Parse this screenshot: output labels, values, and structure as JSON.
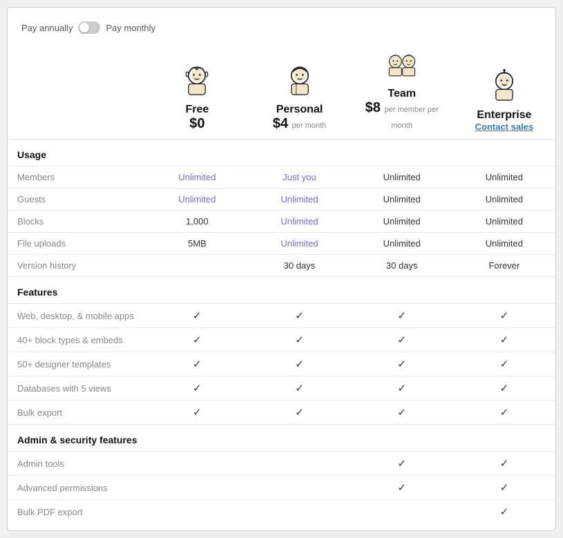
{
  "billing": {
    "pay_annually": "Pay annually",
    "pay_monthly": "Pay monthly"
  },
  "plans": [
    {
      "id": "free",
      "name": "Free",
      "price": "$0",
      "price_sub": "",
      "contact": null,
      "avatar": "free"
    },
    {
      "id": "personal",
      "name": "Personal",
      "price": "$4",
      "price_sub": "per month",
      "contact": null,
      "avatar": "personal"
    },
    {
      "id": "team",
      "name": "Team",
      "price": "$8",
      "price_sub": "per member per month",
      "contact": null,
      "avatar": "team"
    },
    {
      "id": "enterprise",
      "name": "Enterprise",
      "price": null,
      "price_sub": null,
      "contact": "Contact sales",
      "avatar": "enterprise"
    }
  ],
  "sections": [
    {
      "title": "Usage",
      "rows": [
        {
          "label": "Members",
          "values": [
            {
              "text": "Unlimited",
              "type": "purple"
            },
            {
              "text": "Just you",
              "type": "purple"
            },
            {
              "text": "Unlimited",
              "type": "normal"
            },
            {
              "text": "Unlimited",
              "type": "normal"
            }
          ]
        },
        {
          "label": "Guests",
          "values": [
            {
              "text": "Unlimited",
              "type": "purple"
            },
            {
              "text": "Unlimited",
              "type": "purple"
            },
            {
              "text": "Unlimited",
              "type": "normal"
            },
            {
              "text": "Unlimited",
              "type": "normal"
            }
          ]
        },
        {
          "label": "Blocks",
          "values": [
            {
              "text": "1,000",
              "type": "normal"
            },
            {
              "text": "Unlimited",
              "type": "purple"
            },
            {
              "text": "Unlimited",
              "type": "normal"
            },
            {
              "text": "Unlimited",
              "type": "normal"
            }
          ]
        },
        {
          "label": "File uploads",
          "values": [
            {
              "text": "5MB",
              "type": "normal"
            },
            {
              "text": "Unlimited",
              "type": "purple"
            },
            {
              "text": "Unlimited",
              "type": "normal"
            },
            {
              "text": "Unlimited",
              "type": "normal"
            }
          ]
        },
        {
          "label": "Version history",
          "values": [
            {
              "text": "",
              "type": "normal"
            },
            {
              "text": "30 days",
              "type": "normal"
            },
            {
              "text": "30 days",
              "type": "normal"
            },
            {
              "text": "Forever",
              "type": "normal"
            }
          ]
        }
      ]
    },
    {
      "title": "Features",
      "rows": [
        {
          "label": "Web, desktop, & mobile apps",
          "values": [
            {
              "text": "✓",
              "type": "check"
            },
            {
              "text": "✓",
              "type": "check"
            },
            {
              "text": "✓",
              "type": "check"
            },
            {
              "text": "✓",
              "type": "check"
            }
          ]
        },
        {
          "label": "40+ block types & embeds",
          "values": [
            {
              "text": "✓",
              "type": "check"
            },
            {
              "text": "✓",
              "type": "check"
            },
            {
              "text": "✓",
              "type": "check"
            },
            {
              "text": "✓",
              "type": "check"
            }
          ]
        },
        {
          "label": "50+ designer templates",
          "values": [
            {
              "text": "✓",
              "type": "check"
            },
            {
              "text": "✓",
              "type": "check"
            },
            {
              "text": "✓",
              "type": "check"
            },
            {
              "text": "✓",
              "type": "check"
            }
          ]
        },
        {
          "label": "Databases with 5 views",
          "values": [
            {
              "text": "✓",
              "type": "check"
            },
            {
              "text": "✓",
              "type": "check"
            },
            {
              "text": "✓",
              "type": "check"
            },
            {
              "text": "✓",
              "type": "check"
            }
          ]
        },
        {
          "label": "Bulk export",
          "values": [
            {
              "text": "✓",
              "type": "check"
            },
            {
              "text": "✓",
              "type": "check"
            },
            {
              "text": "✓",
              "type": "check"
            },
            {
              "text": "✓",
              "type": "check"
            }
          ]
        }
      ]
    },
    {
      "title": "Admin & security features",
      "rows": [
        {
          "label": "Admin tools",
          "values": [
            {
              "text": "",
              "type": "normal"
            },
            {
              "text": "",
              "type": "normal"
            },
            {
              "text": "✓",
              "type": "check"
            },
            {
              "text": "✓",
              "type": "check"
            }
          ]
        },
        {
          "label": "Advanced permissions",
          "values": [
            {
              "text": "",
              "type": "normal"
            },
            {
              "text": "",
              "type": "normal"
            },
            {
              "text": "✓",
              "type": "check"
            },
            {
              "text": "✓",
              "type": "check"
            }
          ]
        },
        {
          "label": "Bulk PDF export",
          "values": [
            {
              "text": "",
              "type": "normal"
            },
            {
              "text": "",
              "type": "normal"
            },
            {
              "text": "",
              "type": "normal"
            },
            {
              "text": "✓",
              "type": "check"
            }
          ]
        }
      ]
    }
  ]
}
